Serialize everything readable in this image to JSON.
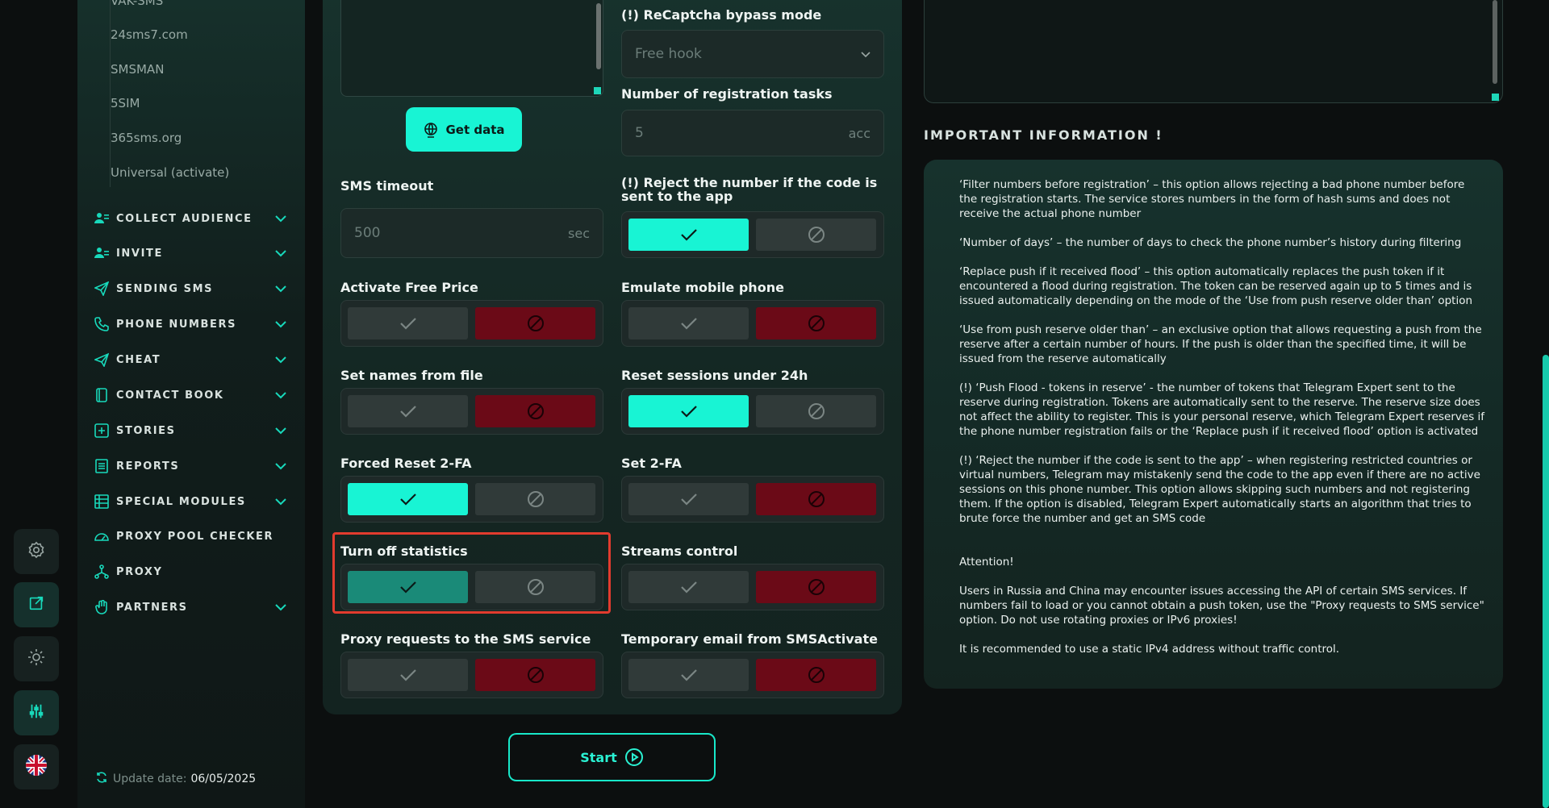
{
  "rail": {
    "icons": [
      "gear-icon",
      "external-link-icon",
      "sun-icon",
      "sliders-icon",
      "uk-flag-icon"
    ]
  },
  "sidebar": {
    "subitems": [
      "VAK-SMS",
      "24sms7.com",
      "SMSMAN",
      "5SIM",
      "365sms.org",
      "Universal (activate)"
    ],
    "nav": [
      {
        "label": "COLLECT AUDIENCE",
        "icon": "users-icon",
        "chevron": true
      },
      {
        "label": "INVITE",
        "icon": "user-plus-icon",
        "chevron": true
      },
      {
        "label": "SENDING SMS",
        "icon": "send-icon",
        "chevron": true
      },
      {
        "label": "PHONE NUMBERS",
        "icon": "phone-icon",
        "chevron": true
      },
      {
        "label": "CHEAT",
        "icon": "megaphone-icon",
        "chevron": true
      },
      {
        "label": "CONTACT BOOK",
        "icon": "book-icon",
        "chevron": true
      },
      {
        "label": "STORIES",
        "icon": "plus-square-icon",
        "chevron": true
      },
      {
        "label": "REPORTS",
        "icon": "report-icon",
        "chevron": true
      },
      {
        "label": "SPECIAL MODULES",
        "icon": "table-icon",
        "chevron": true
      },
      {
        "label": "PROXY POOL CHECKER",
        "icon": "gauge-icon",
        "chevron": false
      },
      {
        "label": "PROXY",
        "icon": "network-icon",
        "chevron": false
      },
      {
        "label": "PARTNERS",
        "icon": "hand-icon",
        "chevron": true
      }
    ],
    "update_label": "Update date:",
    "update_value": "06/05/2025"
  },
  "settings": {
    "get_data": "Get data",
    "sms_timeout": {
      "label": "SMS timeout",
      "value": "500",
      "unit": "sec"
    },
    "recaptcha": {
      "label": "(!) ReCaptcha bypass mode",
      "value": "Free hook"
    },
    "reg_tasks": {
      "label": "Number of registration tasks",
      "value": "5",
      "unit": "acc"
    },
    "reject_label": "(!) Reject the number if the code is sent to the app",
    "toggles": [
      {
        "label": "Activate Free Price",
        "state": "off"
      },
      {
        "label": "Emulate mobile phone",
        "state": "off"
      },
      {
        "label": "Set names from file",
        "state": "off"
      },
      {
        "label": "Reset sessions under 24h",
        "state": "on"
      },
      {
        "label": "Forced Reset 2-FA",
        "state": "on"
      },
      {
        "label": "Set 2-FA",
        "state": "off"
      },
      {
        "label": "Turn off statistics",
        "state": "on-dim"
      },
      {
        "label": "Streams control",
        "state": "off"
      },
      {
        "label": "Proxy requests to the SMS service",
        "state": "off"
      },
      {
        "label": "Temporary email from SMSActivate",
        "state": "off"
      }
    ],
    "reject_state": "on",
    "start": "Start"
  },
  "info": {
    "title": "IMPORTANT INFORMATION !",
    "paragraphs": [
      "‘Filter numbers before registration’ – this option allows rejecting a bad phone number before the registration starts. The service stores numbers in the form of hash sums and does not receive the actual phone number",
      "‘Number of days’ – the number of days to check the phone number’s history during filtering",
      "‘Replace push if it received flood’ – this option automatically replaces the push token if it encountered a flood during registration. The token can be reserved again up to 5 times and is issued automatically depending on the mode of the ‘Use from push reserve older than’ option",
      "‘Use from push reserve older than’ – an exclusive option that allows requesting a push from the reserve after a certain number of hours. If the push is older than the specified time, it will be issued from the reserve automatically",
      "(!) ‘Push Flood - tokens in reserve’ - the number of tokens that Telegram Expert sent to the reserve during registration. Tokens are automatically sent to the reserve. The reserve size does not affect the ability to register. This is your personal reserve, which Telegram Expert reserves if the phone number registration fails or the ‘Replace push if it received flood’ option is activated",
      "(!) ‘Reject the number if the code is sent to the app’ – when registering restricted countries or virtual numbers, Telegram may mistakenly send the code to the app even if there are no active sessions on this phone number. This option allows skipping such numbers and not registering them. If the option is disabled, Telegram Expert automatically starts an algorithm that tries to brute force the number and get an SMS code",
      "Attention!",
      "Users in Russia and China may encounter issues accessing the API of certain SMS services. If numbers fail to load or you cannot obtain a push token, use the \"Proxy requests to SMS service\" option. Do not use rotating proxies or IPv6 proxies!",
      "It is recommended to use a static IPv4 address without traffic control."
    ]
  },
  "colors": {
    "accent": "#18f4d4",
    "danger": "#6b0a17",
    "highlight": "#e23b2e"
  }
}
